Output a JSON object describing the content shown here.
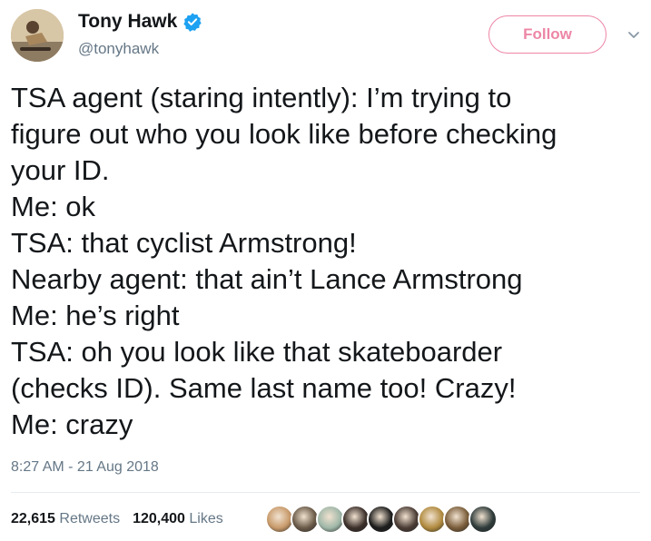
{
  "header": {
    "name": "Tony Hawk",
    "handle": "@tonyhawk",
    "follow_label": "Follow"
  },
  "tweet": {
    "lines": [
      "TSA agent (staring intently): I’m trying to",
      "figure out who you look like before checking",
      "your ID.",
      "Me: ok",
      "TSA: that cyclist Armstrong!",
      "Nearby agent: that ain’t Lance Armstrong",
      "Me: he’s right",
      "TSA: oh you look like that skateboarder",
      "(checks ID). Same last name too! Crazy!",
      "Me: crazy"
    ],
    "timestamp": "8:27 AM - 21 Aug 2018"
  },
  "stats": {
    "retweets_count": "22,615",
    "retweets_label": "Retweets",
    "likes_count": "120,400",
    "likes_label": "Likes"
  },
  "likers": [
    {
      "color": "#c89a6a"
    },
    {
      "color": "#6a5a48"
    },
    {
      "color": "#9fb7a8"
    },
    {
      "color": "#3b2f2a"
    },
    {
      "color": "#1c1c1c"
    },
    {
      "color": "#4a3b34"
    },
    {
      "color": "#b08a3e"
    },
    {
      "color": "#7a5d3a"
    },
    {
      "color": "#2e3b3a"
    }
  ],
  "colors": {
    "follow_accent": "#e0245e",
    "verified_blue": "#1da1f2",
    "secondary_text": "#657786"
  }
}
